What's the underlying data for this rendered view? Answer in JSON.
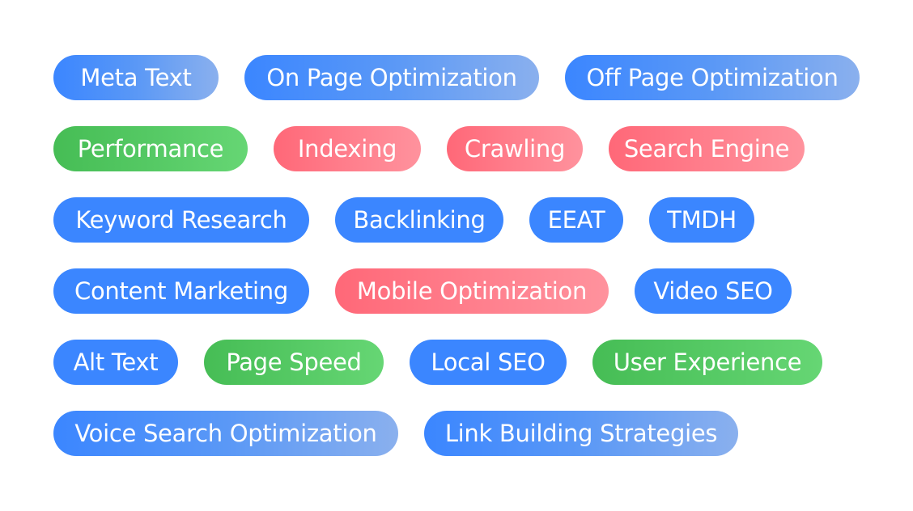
{
  "tags": [
    {
      "label": "Meta Text",
      "style": "blue-grad"
    },
    {
      "label": "On Page Optimization",
      "style": "blue-grad"
    },
    {
      "label": "Off Page Optimization",
      "style": "blue-grad"
    },
    {
      "label": "Performance",
      "style": "green-grad"
    },
    {
      "label": "Indexing",
      "style": "red-grad"
    },
    {
      "label": "Crawling",
      "style": "red-grad"
    },
    {
      "label": "Search Engine",
      "style": "red-grad"
    },
    {
      "label": "Keyword Research",
      "style": "blue-solid"
    },
    {
      "label": "Backlinking",
      "style": "blue-solid"
    },
    {
      "label": "EEAT",
      "style": "blue-solid"
    },
    {
      "label": "TMDH",
      "style": "blue-solid"
    },
    {
      "label": "Content Marketing",
      "style": "blue-solid"
    },
    {
      "label": "Mobile Optimization",
      "style": "red-grad"
    },
    {
      "label": "Video SEO",
      "style": "blue-solid"
    },
    {
      "label": "Alt Text",
      "style": "blue-solid"
    },
    {
      "label": "Page Speed",
      "style": "green-grad"
    },
    {
      "label": "Local SEO",
      "style": "blue-solid"
    },
    {
      "label": "User Experience",
      "style": "green-grad"
    },
    {
      "label": "Voice Search Optimization",
      "style": "blue-grad"
    },
    {
      "label": "Link Building Strategies",
      "style": "blue-grad"
    }
  ],
  "colors": {
    "blue": "#3b86ff",
    "blue_light": "#8ab0ee",
    "red": "#ff6878",
    "red_light": "#ff929d",
    "green": "#46bd55",
    "green_light": "#66d674"
  }
}
